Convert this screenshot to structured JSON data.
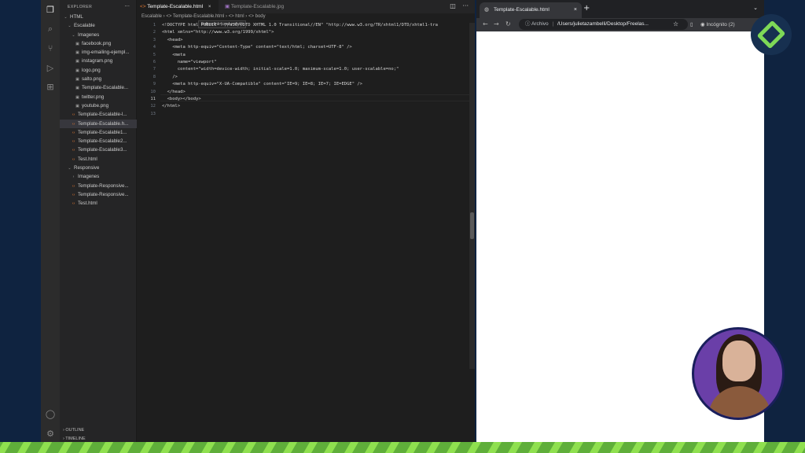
{
  "vscode": {
    "explorer_title": "EXPLORER",
    "more_label": "···",
    "tree": [
      {
        "label": "HTML",
        "icon": "chevron-down",
        "depth": 0
      },
      {
        "label": "Escalable",
        "icon": "chevron-down",
        "depth": 1
      },
      {
        "label": "Imagenes",
        "icon": "chevron-down",
        "depth": 2
      },
      {
        "label": "facebook.png",
        "icon": "image",
        "depth": 3
      },
      {
        "label": "img-emailing-ejempl...",
        "icon": "image",
        "depth": 3
      },
      {
        "label": "instagram.png",
        "icon": "image",
        "depth": 3
      },
      {
        "label": "logo.png",
        "icon": "image",
        "depth": 3
      },
      {
        "label": "salto.png",
        "icon": "image",
        "depth": 3
      },
      {
        "label": "Template-Escalable...",
        "icon": "image",
        "depth": 3
      },
      {
        "label": "twitter.png",
        "icon": "image",
        "depth": 3
      },
      {
        "label": "youtube.png",
        "icon": "image",
        "depth": 3
      },
      {
        "label": "Template-Escalable-l...",
        "icon": "html",
        "depth": 2
      },
      {
        "label": "Template-Escalable.h...",
        "icon": "html",
        "depth": 2,
        "selected": true
      },
      {
        "label": "Template-Escalable1...",
        "icon": "html",
        "depth": 2
      },
      {
        "label": "Template-Escalable2...",
        "icon": "html",
        "depth": 2
      },
      {
        "label": "Template-Escalable3...",
        "icon": "html",
        "depth": 2
      },
      {
        "label": "Test.html",
        "icon": "html",
        "depth": 2
      },
      {
        "label": "Responsive",
        "icon": "chevron-down",
        "depth": 1
      },
      {
        "label": "Imagenes",
        "icon": "chevron-right",
        "depth": 2
      },
      {
        "label": "Template-Responsive...",
        "icon": "html",
        "depth": 2
      },
      {
        "label": "Template-Responsive...",
        "icon": "html",
        "depth": 2
      },
      {
        "label": "Test.html",
        "icon": "html",
        "depth": 2
      }
    ],
    "outline_label": "OUTLINE",
    "timeline_label": "TIMELINE",
    "tabs": [
      {
        "label": "Template-Escalable.html",
        "close": "×"
      },
      {
        "label": "Template-Escalable.jpg"
      }
    ],
    "breadcrumb": "Escalable › <> Template-Escalable.html › <> html › <> body",
    "tooltip": "Follow link (cmd + click)",
    "code_lines": [
      {
        "n": "1",
        "text": "<!DOCTYPE html PUBLIC \"-//W3C//DTD XHTML 1.0 Transitional//EN\" \"http://www.w3.org/TR/xhtml1/DTD/xhtml1-tra"
      },
      {
        "n": "2",
        "text": "<html xmlns=\"http://www.w3.org/1999/xhtml\">"
      },
      {
        "n": "3",
        "text": "  <head>"
      },
      {
        "n": "4",
        "text": "    <meta http-equiv=\"Content-Type\" content=\"text/html; charset=UTF-8\" />"
      },
      {
        "n": "5",
        "text": "    <meta"
      },
      {
        "n": "6",
        "text": "      name=\"viewport\""
      },
      {
        "n": "7",
        "text": "      content=\"width=device-width; initial-scale=1.0; maximum-scale=1.0; user-scalable=no;\""
      },
      {
        "n": "8",
        "text": "    />"
      },
      {
        "n": "9",
        "text": "    <meta http-equiv=\"X-UA-Compatible\" content=\"IE=9; IE=8; IE=7; IE=EDGE\" />"
      },
      {
        "n": "10",
        "text": "  </head>"
      },
      {
        "n": "11",
        "text": "  <body></body>"
      },
      {
        "n": "12",
        "text": "</html>"
      },
      {
        "n": "13",
        "text": ""
      }
    ]
  },
  "browser": {
    "tab_title": "Template-Escalable.html",
    "tab_close": "×",
    "new_tab": "+",
    "file_label": "Archivo",
    "url": "/Users/julietazambelli/Desktop/Freelas...",
    "incognito_label": "Incógnito (2)"
  },
  "colors": {
    "brand_green": "#7ed957",
    "background_navy": "#0f2340",
    "webcam_purple": "#6a3fa8"
  }
}
